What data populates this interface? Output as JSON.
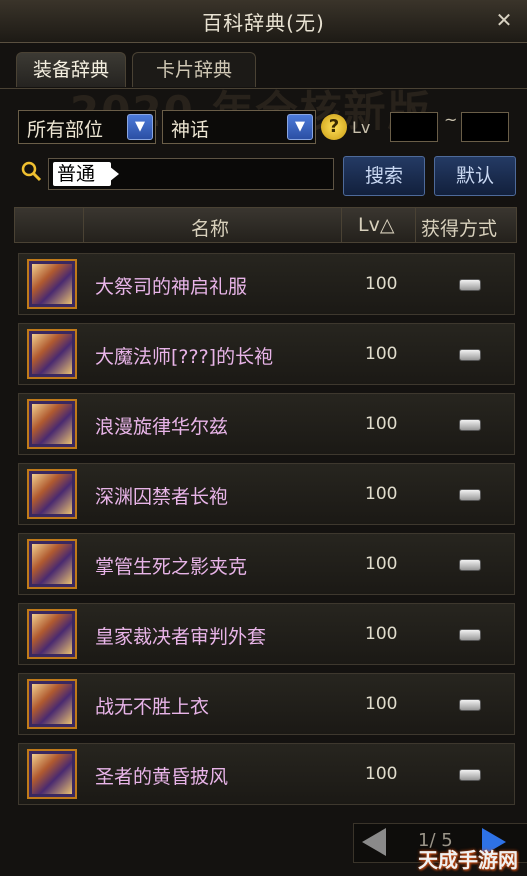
{
  "window": {
    "title": "百科辞典(无)",
    "close_label": "✕"
  },
  "tabs": [
    {
      "label": "装备辞典",
      "active": true
    },
    {
      "label": "卡片辞典",
      "active": false
    }
  ],
  "background_banner": "2020 年全核新版",
  "filters": {
    "part": "所有部位",
    "rarity": "神话",
    "help_label": "?",
    "lv_label": "Lv",
    "lv_min": "",
    "lv_max": "",
    "lv_separator": "~"
  },
  "search": {
    "chip": "普通",
    "value": "",
    "search_button": "搜索",
    "default_button": "默认"
  },
  "table": {
    "headers": {
      "name": "名称",
      "lv": "Lv△",
      "source": "获得方式"
    },
    "rows": [
      {
        "name": "大祭司的神启礼服",
        "lv": "100"
      },
      {
        "name": "大魔法师[???]的长袍",
        "lv": "100"
      },
      {
        "name": "浪漫旋律华尔兹",
        "lv": "100"
      },
      {
        "name": "深渊囚禁者长袍",
        "lv": "100"
      },
      {
        "name": "掌管生死之影夹克",
        "lv": "100"
      },
      {
        "name": "皇家裁决者审判外套",
        "lv": "100"
      },
      {
        "name": "战无不胜上衣",
        "lv": "100"
      },
      {
        "name": "圣者的黄昏披风",
        "lv": "100"
      }
    ]
  },
  "pager": {
    "text": "1/ 5"
  },
  "watermark": "天成手游网",
  "colors": {
    "item_name": "#e8b4e8",
    "button_bg": "#1a2c50",
    "next_arrow": "#2e72e6",
    "help_icon": "#f0c020"
  }
}
